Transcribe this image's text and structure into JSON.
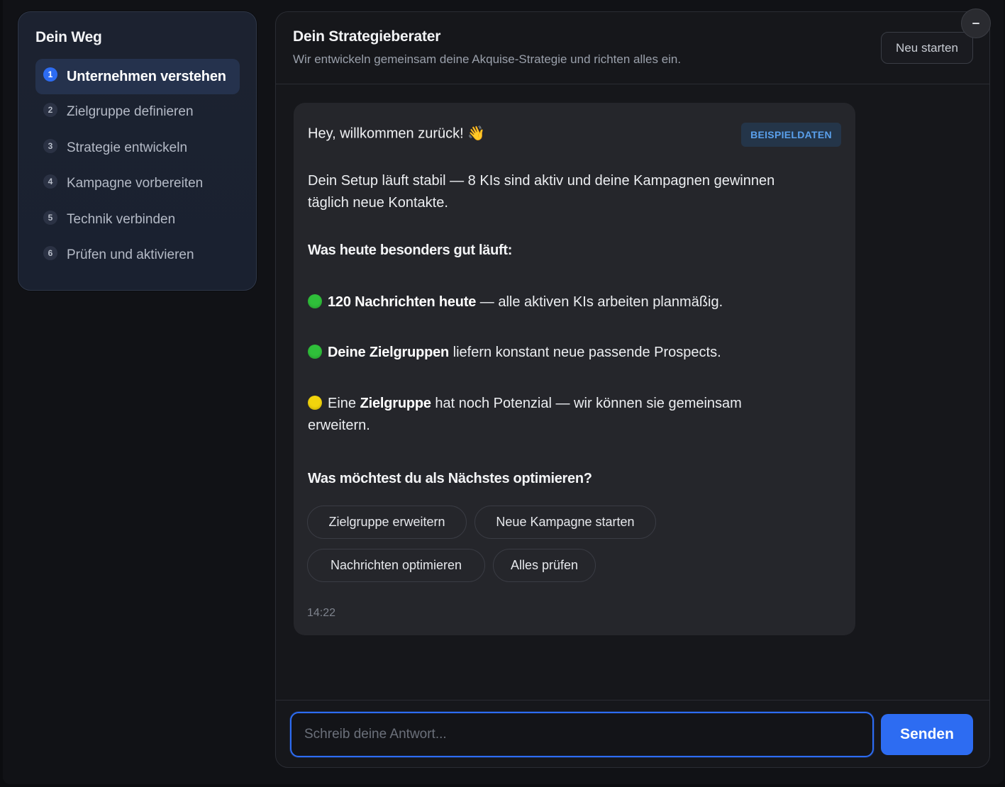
{
  "sidebar": {
    "title": "Dein Weg",
    "steps": [
      {
        "num": "1",
        "label": "Unternehmen verstehen"
      },
      {
        "num": "2",
        "label": "Zielgruppe definieren"
      },
      {
        "num": "3",
        "label": "Strategie entwickeln"
      },
      {
        "num": "4",
        "label": "Kampagne vorbereiten"
      },
      {
        "num": "5",
        "label": "Technik verbinden"
      },
      {
        "num": "6",
        "label": "Prüfen und aktivieren"
      }
    ],
    "active_step": 1
  },
  "header": {
    "title": "Dein Strategieberater",
    "subtitle": "Wir entwickeln gemeinsam deine Akquise-Strategie und richten alles ein.",
    "restart_label": "Neu starten",
    "minimize_icon": "minus-icon"
  },
  "message": {
    "greeting": "Hey, willkommen zurück! 👋",
    "badge": "BEISPIELDATEN",
    "intro": "Dein Setup läuft stabil — 8 KIs sind aktiv und deine Kampagnen gewinnen täglich neue Kontakte.",
    "section_heading": "Was heute besonders gut läuft:",
    "bullets": [
      {
        "status": "green",
        "bold": "120 Nachrichten heute",
        "pre": "",
        "text": " — alle aktiven KIs arbeiten planmäßig."
      },
      {
        "status": "green",
        "bold": "Deine Zielgruppen",
        "pre": "",
        "text": " liefern konstant neue passende Prospects."
      },
      {
        "status": "yellow",
        "bold": "Zielgruppe",
        "pre": "Eine ",
        "text": " hat noch Potenzial — wir können sie gemeinsam erweitern."
      }
    ],
    "question": "Was möchtest du als Nächstes optimieren?",
    "options": [
      "Zielgruppe erweitern",
      "Neue Kampagne starten",
      "Nachrichten optimieren",
      "Alles prüfen"
    ],
    "time": "14:22"
  },
  "composer": {
    "placeholder": "Schreib deine Antwort...",
    "value": "",
    "send_label": "Senden"
  },
  "colors": {
    "accent": "#2d6cf2",
    "status_green": "#2fbf3a",
    "status_yellow": "#f2d40c",
    "badge_text": "#5aa0ec"
  }
}
